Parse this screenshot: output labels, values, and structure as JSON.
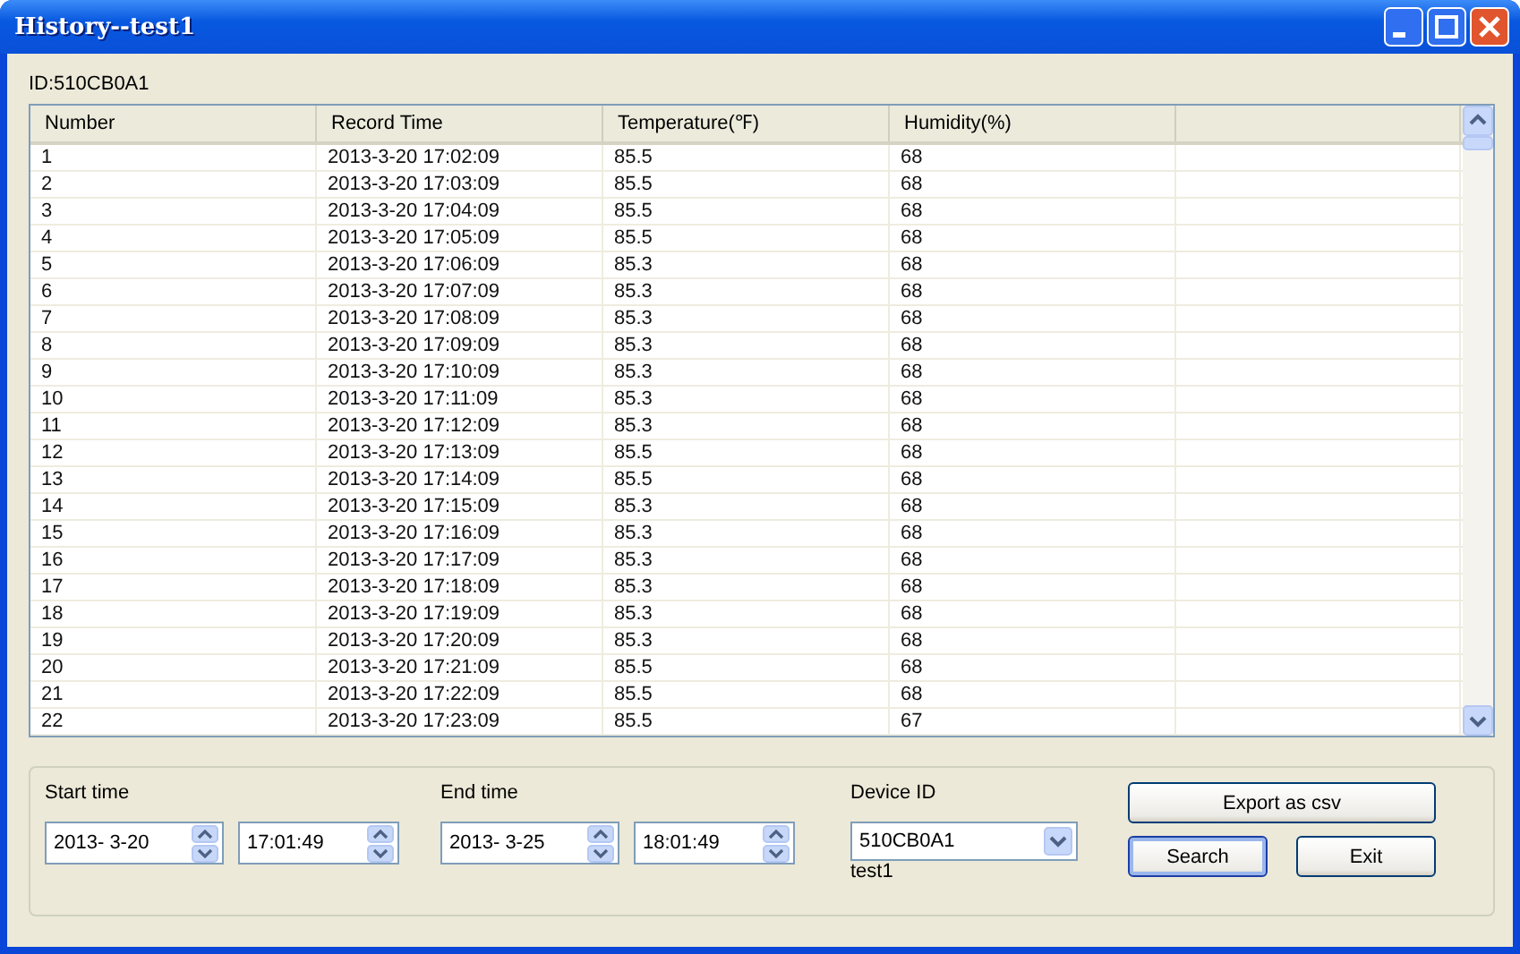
{
  "window": {
    "title": "History--test1"
  },
  "id_label": "ID:510CB0A1",
  "table": {
    "columns": [
      "Number",
      "Record Time",
      "Temperature(℉)",
      "Humidity(%)"
    ],
    "rows": [
      [
        "1",
        "2013-3-20 17:02:09",
        "85.5",
        "68"
      ],
      [
        "2",
        "2013-3-20 17:03:09",
        "85.5",
        "68"
      ],
      [
        "3",
        "2013-3-20 17:04:09",
        "85.5",
        "68"
      ],
      [
        "4",
        "2013-3-20 17:05:09",
        "85.5",
        "68"
      ],
      [
        "5",
        "2013-3-20 17:06:09",
        "85.3",
        "68"
      ],
      [
        "6",
        "2013-3-20 17:07:09",
        "85.3",
        "68"
      ],
      [
        "7",
        "2013-3-20 17:08:09",
        "85.3",
        "68"
      ],
      [
        "8",
        "2013-3-20 17:09:09",
        "85.3",
        "68"
      ],
      [
        "9",
        "2013-3-20 17:10:09",
        "85.3",
        "68"
      ],
      [
        "10",
        "2013-3-20 17:11:09",
        "85.3",
        "68"
      ],
      [
        "11",
        "2013-3-20 17:12:09",
        "85.3",
        "68"
      ],
      [
        "12",
        "2013-3-20 17:13:09",
        "85.5",
        "68"
      ],
      [
        "13",
        "2013-3-20 17:14:09",
        "85.5",
        "68"
      ],
      [
        "14",
        "2013-3-20 17:15:09",
        "85.3",
        "68"
      ],
      [
        "15",
        "2013-3-20 17:16:09",
        "85.3",
        "68"
      ],
      [
        "16",
        "2013-3-20 17:17:09",
        "85.3",
        "68"
      ],
      [
        "17",
        "2013-3-20 17:18:09",
        "85.3",
        "68"
      ],
      [
        "18",
        "2013-3-20 17:19:09",
        "85.3",
        "68"
      ],
      [
        "19",
        "2013-3-20 17:20:09",
        "85.3",
        "68"
      ],
      [
        "20",
        "2013-3-20 17:21:09",
        "85.5",
        "68"
      ],
      [
        "21",
        "2013-3-20 17:22:09",
        "85.5",
        "68"
      ],
      [
        "22",
        "2013-3-20 17:23:09",
        "85.5",
        "67"
      ]
    ]
  },
  "filters": {
    "start_label": "Start time",
    "start_date": "2013-  3-20",
    "start_time": "17:01:49",
    "end_label": "End time",
    "end_date": "2013-  3-25",
    "end_time": "18:01:49",
    "device_label": "Device ID",
    "device_value": "510CB0A1",
    "device_name": "test1"
  },
  "buttons": [
    {
      "label": "Export as csv",
      "kind": "wide"
    },
    {
      "label": "Search",
      "kind": "default"
    },
    {
      "label": "Exit",
      "kind": "normal"
    }
  ]
}
